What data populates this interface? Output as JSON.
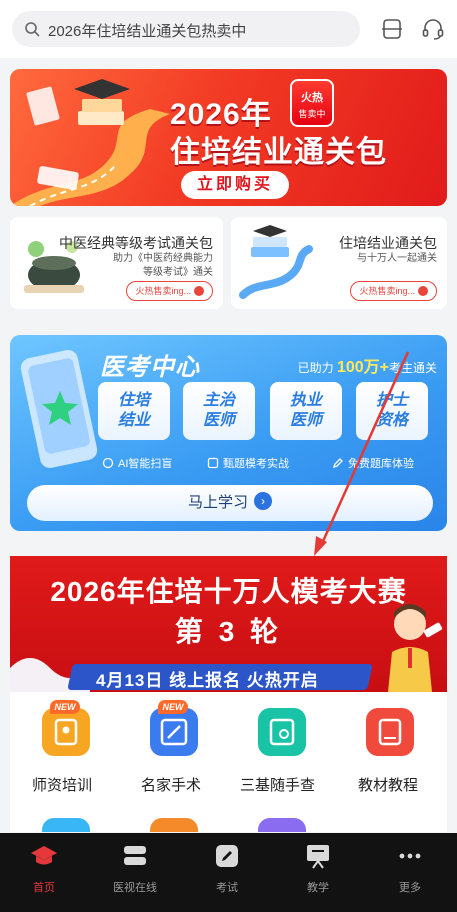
{
  "search": {
    "placeholder": "2026年住培结业通关包热卖中"
  },
  "header_icons": [
    "scan-icon",
    "headset-icon"
  ],
  "banner_top": {
    "title_line1": "2026年",
    "title_line2": "住培结业通关包",
    "badge_line1": "火热",
    "badge_line2": "售卖中",
    "button": "立即购买"
  },
  "cards": [
    {
      "title": "中医经典等级考试通关包",
      "subtitle_line1": "助力《中医药经典能力",
      "subtitle_line2": "等级考试》通关",
      "pill": "火热售卖ing..."
    },
    {
      "title": "住培结业通关包",
      "subtitle_line1": "与十万人一起通关",
      "subtitle_line2": "",
      "pill": "火热售卖ing..."
    }
  ],
  "exam_center": {
    "title": "医考中心",
    "help_prefix": "已助力",
    "help_number": "100万+",
    "help_suffix": "考生通关",
    "tiles": [
      {
        "line1": "住培",
        "line2": "结业"
      },
      {
        "line1": "主治",
        "line2": "医师"
      },
      {
        "line1": "执业",
        "line2": "医师"
      },
      {
        "line1": "护士",
        "line2": "资格"
      }
    ],
    "features": [
      "AI智能扫盲",
      "甄题模考实战",
      "免费题库体验"
    ],
    "button": "马上学习"
  },
  "contest_banner": {
    "line1": "2026年住培十万人模考大赛",
    "line2": "第 3 轮",
    "info": "4月13日 线上报名 火热开启"
  },
  "grid_items": [
    {
      "label": "师资培训",
      "new": "NEW",
      "color": "#f7a623"
    },
    {
      "label": "名家手术",
      "new": "NEW",
      "color": "#3b7bf0"
    },
    {
      "label": "三基随手查",
      "new": "",
      "color": "#19c3a6"
    },
    {
      "label": "教材教程",
      "new": "",
      "color": "#f04a3c"
    }
  ],
  "tabs": [
    {
      "label": "首页",
      "active": true
    },
    {
      "label": "医视在线",
      "active": false
    },
    {
      "label": "考试",
      "active": false
    },
    {
      "label": "教学",
      "active": false
    },
    {
      "label": "更多",
      "active": false
    }
  ],
  "colors": {
    "accent": "#e5383b",
    "exam_blue": "#3a9cf3",
    "tabbar": "#121212"
  }
}
